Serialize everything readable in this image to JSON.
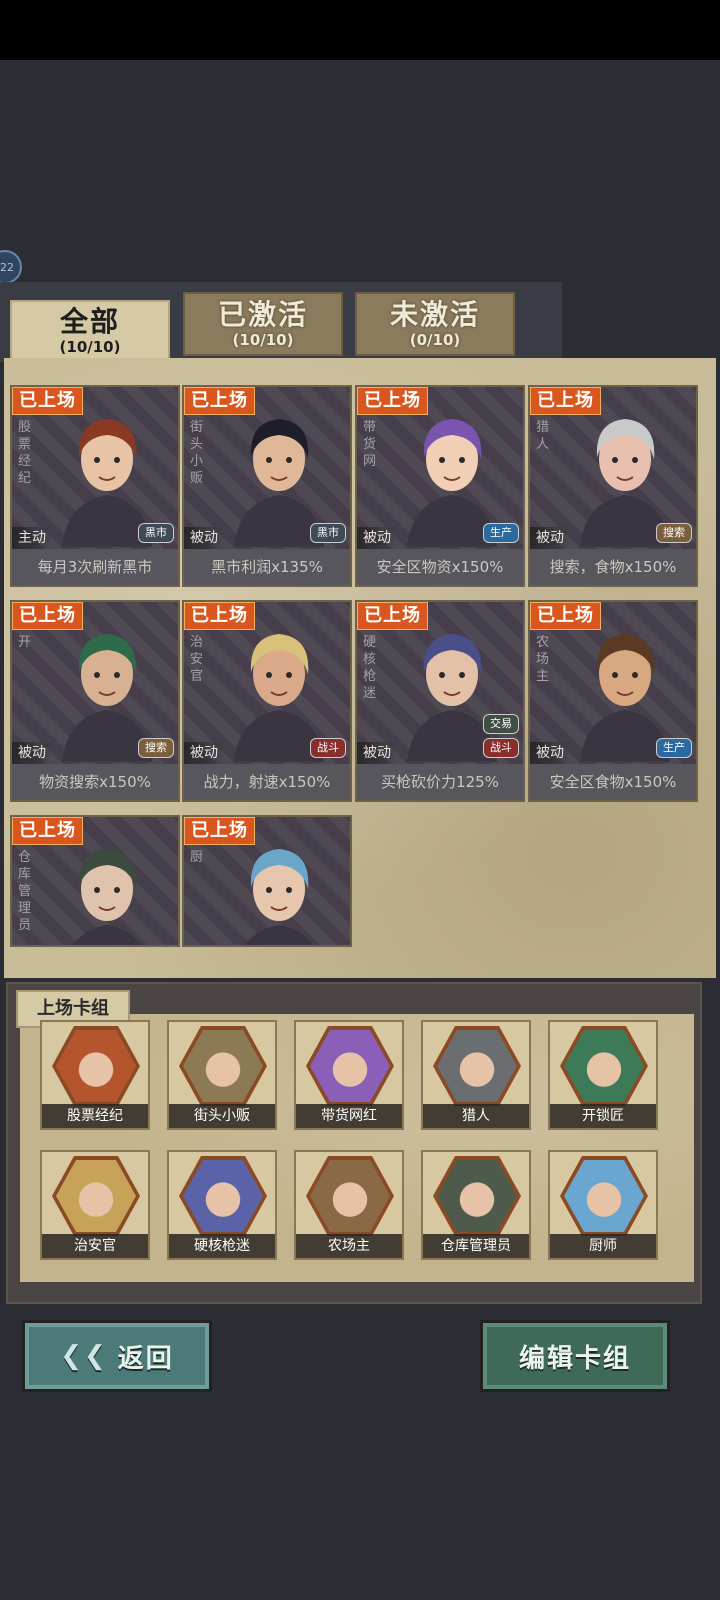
{
  "badge": "22",
  "tabs": [
    {
      "title": "全部",
      "count": "(10/10)"
    },
    {
      "title": "已激活",
      "count": "(10/10)"
    },
    {
      "title": "未激活",
      "count": "(0/10)"
    }
  ],
  "ribbon_label": "已上场",
  "cards": [
    {
      "name": "股票经纪",
      "type": "主动",
      "tag": "黑市",
      "desc": "每月3次刷新黑市",
      "skin": "#e8c3a5",
      "hair": "#8a3a22"
    },
    {
      "name": "街头小贩",
      "type": "被动",
      "tag": "黑市",
      "desc": "黑市利润x135%",
      "skin": "#e0b898",
      "hair": "#1e1e2a"
    },
    {
      "name": "带货网",
      "type": "被动",
      "tag": "生产",
      "desc": "安全区物资x150%",
      "skin": "#f0cfb6",
      "hair": "#7a55b0"
    },
    {
      "name": "猎人",
      "type": "被动",
      "tag": "搜索",
      "desc": "搜索，食物x150%",
      "skin": "#e9c0b0",
      "hair": "#c9c9c9"
    },
    {
      "name": "开",
      "type": "被动",
      "tag": "搜索",
      "desc": "物资搜索x150%",
      "skin": "#d8b092",
      "hair": "#2f6a4a"
    },
    {
      "name": "治安官",
      "type": "被动",
      "tag": "战斗",
      "desc": "战力，射速x150%",
      "skin": "#d9a989",
      "hair": "#d8c27a"
    },
    {
      "name": "硬核枪迷",
      "type": "被动",
      "tag": "战斗",
      "tag2": "交易",
      "desc": "买枪砍价力125%",
      "skin": "#e3c0a8",
      "hair": "#4a4f8a"
    },
    {
      "name": "农场主",
      "type": "被动",
      "tag": "生产",
      "desc": "安全区食物x150%",
      "skin": "#d8a880",
      "hair": "#5a3a22"
    },
    {
      "name": "仓库管理员",
      "skin": "#dfc3ad",
      "hair": "#3d4a3e"
    },
    {
      "name": "厨",
      "skin": "#e7c6ae",
      "hair": "#6aa6c9"
    }
  ],
  "deck": {
    "label": "上场卡组",
    "slots": [
      {
        "name": "股票经纪",
        "color": "#b5552e"
      },
      {
        "name": "街头小贩",
        "color": "#8c7a55"
      },
      {
        "name": "带货网红",
        "color": "#8b5fb8"
      },
      {
        "name": "猎人",
        "color": "#6a6e70"
      },
      {
        "name": "开锁匠",
        "color": "#3c7a58"
      },
      {
        "name": "治安官",
        "color": "#c9a25a"
      },
      {
        "name": "硬核枪迷",
        "color": "#5a63a8"
      },
      {
        "name": "农场主",
        "color": "#8a6a44"
      },
      {
        "name": "仓库管理员",
        "color": "#4d5a4c"
      },
      {
        "name": "厨师",
        "color": "#6aa6d0"
      }
    ]
  },
  "buttons": {
    "back": "返回",
    "edit": "编辑卡组"
  }
}
